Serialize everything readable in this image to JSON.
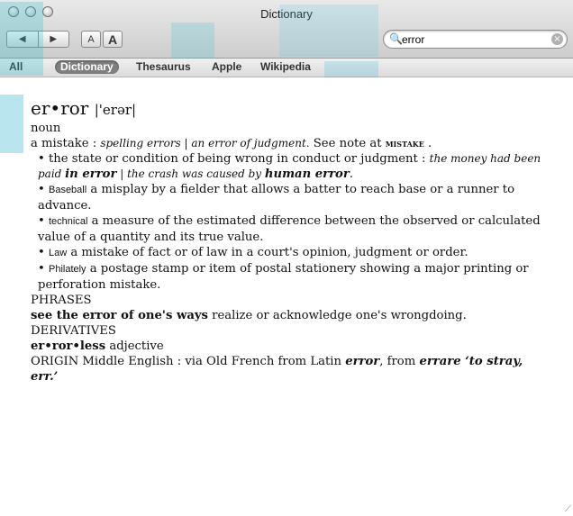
{
  "window": {
    "title": "Dictionary"
  },
  "toolbar": {
    "back_glyph": "◀",
    "forward_glyph": "▶",
    "font_smaller_label": "A",
    "font_larger_label": "A"
  },
  "search": {
    "value": "error",
    "glass_glyph": "🔍",
    "clear_glyph": "×"
  },
  "scopes": [
    {
      "label": "All"
    },
    {
      "label": "Dictionary",
      "selected": true
    },
    {
      "label": "Thesaurus"
    },
    {
      "label": "Apple"
    },
    {
      "label": "Wikipedia"
    }
  ],
  "entry": {
    "headword": "er•ror",
    "pronunciation": "|'erər|",
    "pos": "noun",
    "def_lead": "a mistake : ",
    "def_examples": "spelling errors | an error of judgment.",
    "def_note": " See note at ",
    "def_note_ref": "mistake",
    "def_note_end": " .",
    "sense1_text": "• the state or condition of being wrong in conduct or judgment : ",
    "sense1_ex1": "the money had been paid ",
    "sense1_ex1_bold": "in error",
    "sense1_sep": " | ",
    "sense1_ex2": "the crash was caused by ",
    "sense1_ex2_bold": "human error",
    "sense1_end": ".",
    "sense2_bullet": "• ",
    "sense2_label": "Baseball",
    "sense2_text": " a misplay by a fielder that allows a batter to reach base or a runner to advance.",
    "sense3_bullet": "• ",
    "sense3_label": "technical",
    "sense3_text": " a measure of the estimated difference between the observed or calculated value of a quantity and its true value.",
    "sense4_bullet": "• ",
    "sense4_label": "Law",
    "sense4_text": " a mistake of fact or of law in a court's opinion, judgment or order.",
    "sense5_bullet": "• ",
    "sense5_label": "Philately",
    "sense5_text": " a postage stamp or item of postal stationery showing a major printing or perforation mistake.",
    "phrases_heading": "PHRASES",
    "phrase_bold": "see the error of one's ways",
    "phrase_text": " realize or acknowledge one's wrongdoing.",
    "derivatives_heading": "DERIVATIVES",
    "derivative_bold": "er•ror•less",
    "derivative_text": " adjective",
    "origin_lead": "ORIGIN Middle English : via Old French from Latin ",
    "origin_word1": "error",
    "origin_mid": ", from ",
    "origin_word2": "errare",
    "origin_gloss": " ‘to stray, err.’"
  }
}
